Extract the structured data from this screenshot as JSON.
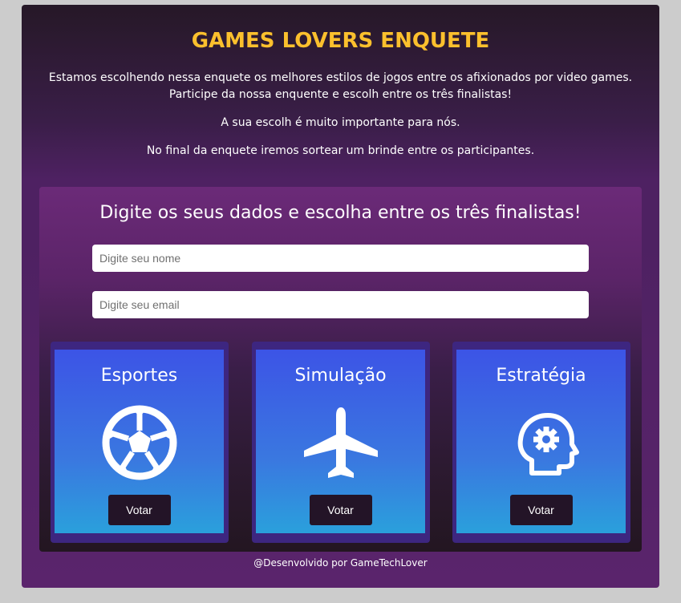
{
  "header": {
    "title": "GAMES LOVERS ENQUETE",
    "intro_line1": "Estamos escolhendo nessa enquete os melhores estilos de jogos entre os afixionados por video games.",
    "intro_line2": "Participe da nossa enquente e escolh entre os três finalistas!",
    "intro_line3": "A sua escolh é muito importante para nós.",
    "intro_line4": "No final da enquete iremos sortear um brinde entre os participantes."
  },
  "form": {
    "heading": "Digite os seus dados e escolha entre os três finalistas!",
    "name_placeholder": "Digite seu nome",
    "email_placeholder": "Digite seu email"
  },
  "options": [
    {
      "title": "Esportes",
      "icon": "soccer-ball-icon",
      "button": "Votar"
    },
    {
      "title": "Simulação",
      "icon": "airplane-icon",
      "button": "Votar"
    },
    {
      "title": "Estratégia",
      "icon": "head-gear-icon",
      "button": "Votar"
    }
  ],
  "footer": {
    "text": "@Desenvolvido por GameTechLover"
  },
  "colors": {
    "title": "#fbc02d",
    "background": "#cccccc",
    "button": "#231427"
  }
}
